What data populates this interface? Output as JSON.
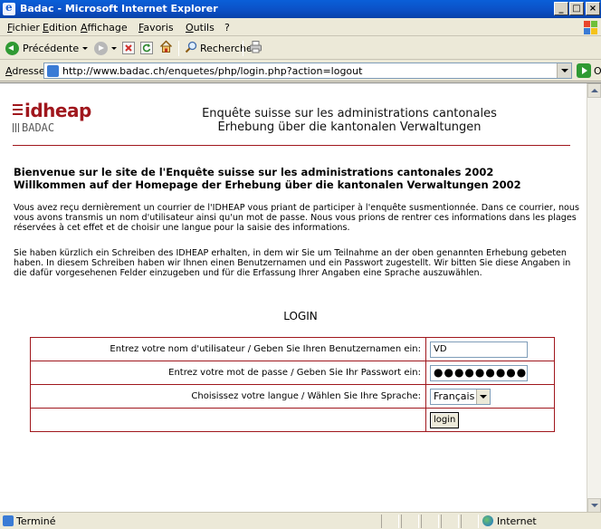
{
  "window": {
    "title": "Badac - Microsoft Internet Explorer",
    "controls": [
      "_",
      "□",
      "×"
    ]
  },
  "menu": [
    "Fichier",
    "Edition",
    "Affichage",
    "Favoris",
    "Outils",
    "?"
  ],
  "toolbar": {
    "back_label": "Précédente",
    "search_label": "Rechercher"
  },
  "address": {
    "label": "Adresse",
    "url": "http://www.badac.ch/enquetes/php/login.php?action=logout",
    "go_label": "OK"
  },
  "page": {
    "logo": {
      "line1": "idheap",
      "line2": "BADAC"
    },
    "header_fr": "Enquête suisse sur les administrations cantonales",
    "header_de": "Erhebung über die kantonalen Verwaltungen",
    "welcome_fr": "Bienvenue sur le site de l'Enquête suisse sur les administrations cantonales 2002",
    "welcome_de": "Willkommen auf der Homepage der Erhebung über die kantonalen Verwaltungen 2002",
    "para_fr": "Vous avez reçu dernièrement un courrier de l'IDHEAP vous priant de participer à l'enquête susmentionnée. Dans ce courrier, nous vous avons transmis un nom d'utilisateur ainsi qu'un mot de passe. Nous vous prions de rentrer ces informations dans les plages réservées à cet effet et de choisir une langue pour la saisie des informations.",
    "para_de": "Sie haben kürzlich ein Schreiben des IDHEAP erhalten, in dem wir Sie um Teilnahme an der oben genannten Erhebung gebeten haben. In diesem Schreiben haben wir Ihnen einen Benutzernamen und ein Passwort zugestellt. Wir bitten Sie diese Angaben in die dafür vorgesehenen Felder einzugeben und für die Erfassung Ihrer Angaben eine Sprache auszuwählen.",
    "login_heading": "LOGIN",
    "form": {
      "username_label": "Entrez votre nom d'utilisateur / Geben Sie Ihren Benutzernamen ein:",
      "username_value": "VD",
      "password_label": "Entrez votre mot de passe / Geben Sie Ihr Passwort ein:",
      "password_value": "●●●●●●●●●",
      "language_label": "Choisissez votre langue / Wählen Sie Ihre Sprache:",
      "language_value": "Français",
      "submit_label": "login"
    }
  },
  "status": {
    "text": "Terminé",
    "zone": "Internet"
  }
}
